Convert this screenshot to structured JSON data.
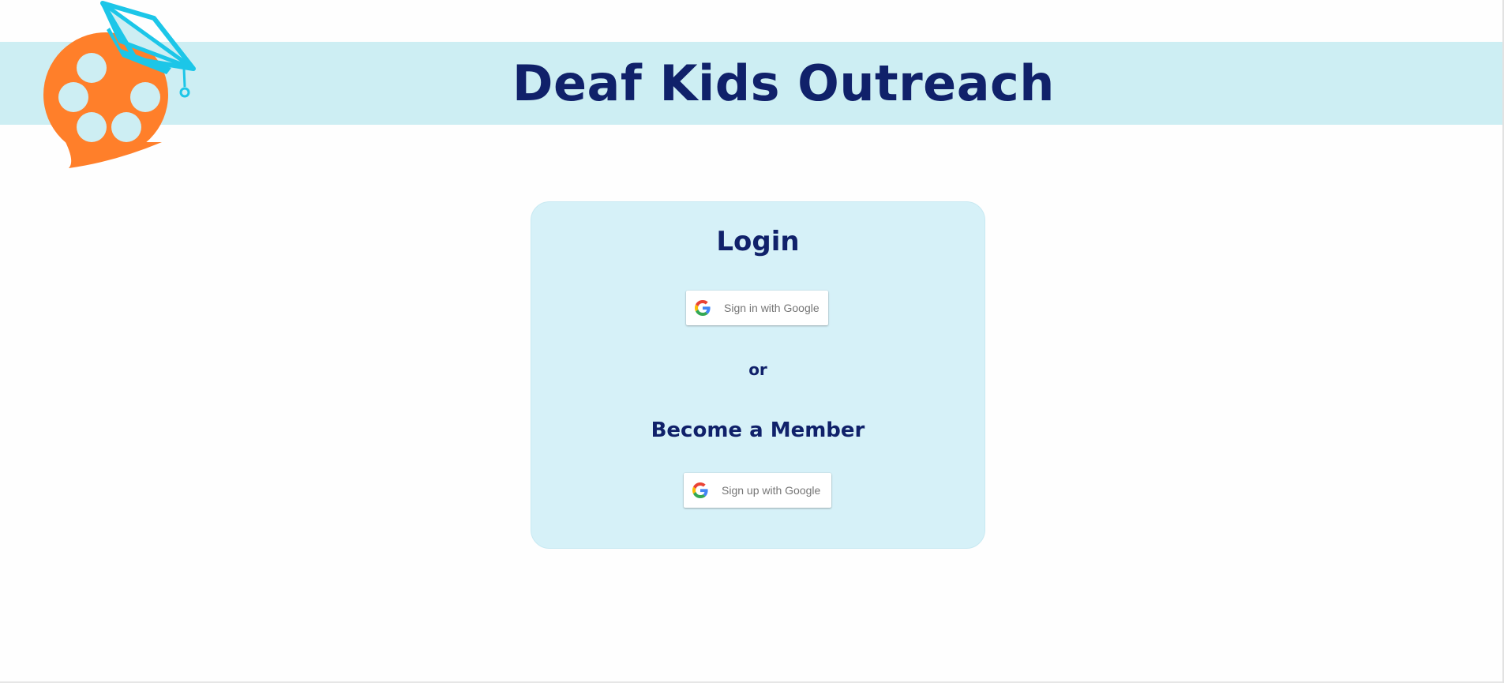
{
  "header": {
    "title": "Deaf Kids Outreach",
    "band_color": "#cdeef3",
    "title_color": "#10216a",
    "logo_icon": "speech-bubble-graduation-cap-logo",
    "logo_colors": {
      "bubble": "#ff7f2a",
      "cap": "#1cc6e8"
    }
  },
  "auth_card": {
    "background": "#d6f1f8",
    "login_title": "Login",
    "signin_button": {
      "label": "Sign in with Google",
      "icon": "google-g-icon"
    },
    "separator": "or",
    "member_title": "Become a Member",
    "signup_button": {
      "label": "Sign up with Google",
      "icon": "google-g-icon"
    }
  }
}
